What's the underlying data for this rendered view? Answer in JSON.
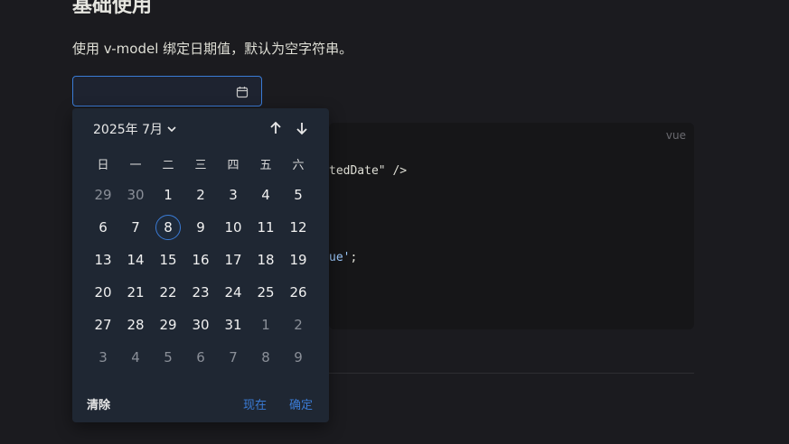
{
  "section": {
    "title": "基础使用",
    "description": "使用 v-model 绑定日期值，默认为空字符串。"
  },
  "date_input": {
    "value": "",
    "icon": "calendar-icon"
  },
  "code": {
    "lang": "vue",
    "line1": "tedDate\" />",
    "line2_str": "ue'",
    "line2_tail": ";"
  },
  "picker": {
    "month_label": "2025年 7月",
    "weekdays": [
      "日",
      "一",
      "二",
      "三",
      "四",
      "五",
      "六"
    ],
    "weeks": [
      [
        {
          "d": "29",
          "o": true
        },
        {
          "d": "30",
          "o": true
        },
        {
          "d": "1"
        },
        {
          "d": "2"
        },
        {
          "d": "3"
        },
        {
          "d": "4"
        },
        {
          "d": "5"
        }
      ],
      [
        {
          "d": "6"
        },
        {
          "d": "7"
        },
        {
          "d": "8",
          "today": true
        },
        {
          "d": "9"
        },
        {
          "d": "10"
        },
        {
          "d": "11"
        },
        {
          "d": "12"
        }
      ],
      [
        {
          "d": "13"
        },
        {
          "d": "14"
        },
        {
          "d": "15"
        },
        {
          "d": "16"
        },
        {
          "d": "17"
        },
        {
          "d": "18"
        },
        {
          "d": "19"
        }
      ],
      [
        {
          "d": "20"
        },
        {
          "d": "21"
        },
        {
          "d": "22"
        },
        {
          "d": "23"
        },
        {
          "d": "24"
        },
        {
          "d": "25"
        },
        {
          "d": "26"
        }
      ],
      [
        {
          "d": "27"
        },
        {
          "d": "28"
        },
        {
          "d": "29"
        },
        {
          "d": "30"
        },
        {
          "d": "31"
        },
        {
          "d": "1",
          "o": true
        },
        {
          "d": "2",
          "o": true
        }
      ],
      [
        {
          "d": "3",
          "o": true
        },
        {
          "d": "4",
          "o": true
        },
        {
          "d": "5",
          "o": true
        },
        {
          "d": "6",
          "o": true
        },
        {
          "d": "7",
          "o": true
        },
        {
          "d": "8",
          "o": true
        },
        {
          "d": "9",
          "o": true
        }
      ]
    ],
    "clear_label": "清除",
    "now_label": "现在",
    "ok_label": "确定"
  },
  "colors": {
    "accent": "#3a7bd5",
    "panel": "#1f2733",
    "background": "#1b1b1f"
  }
}
